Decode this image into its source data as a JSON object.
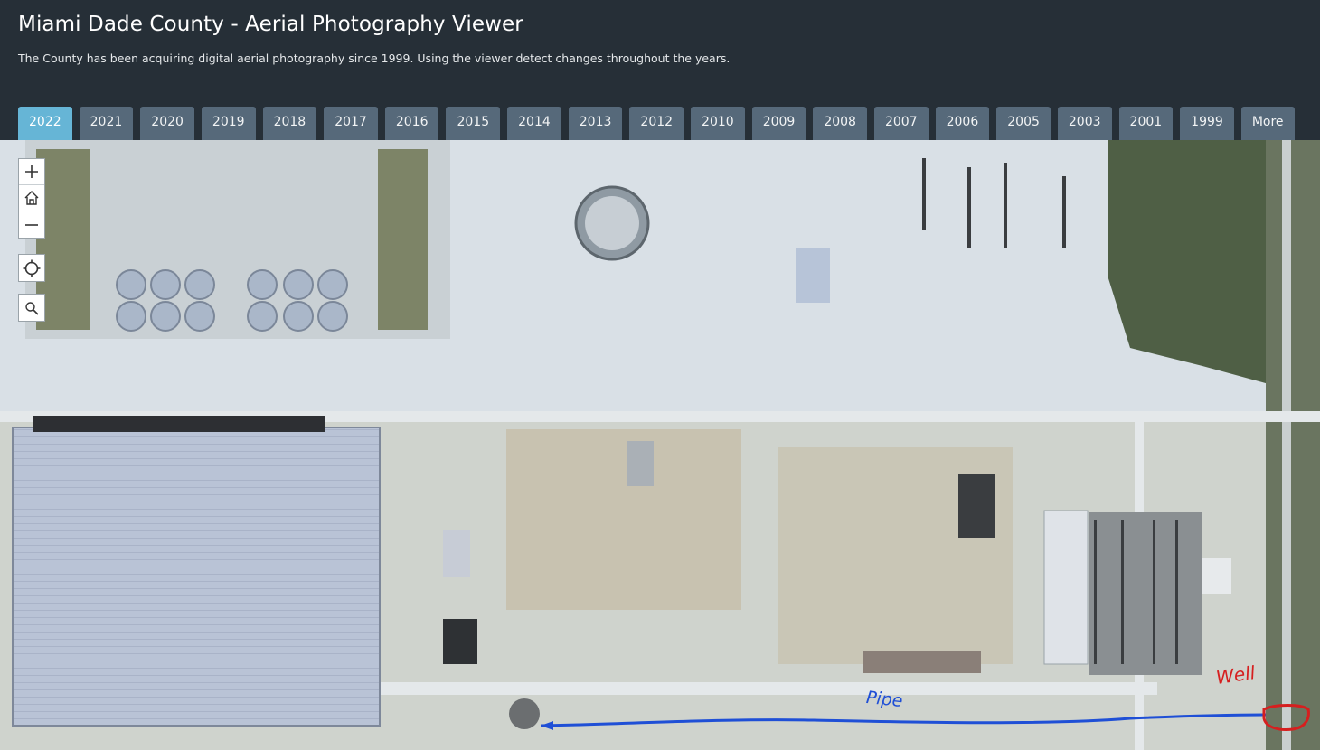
{
  "header": {
    "title": "Miami Dade County - Aerial Photography Viewer",
    "subtitle": "The County has been acquiring digital aerial photography since 1999. Using the viewer detect changes throughout the years."
  },
  "tabs": [
    {
      "label": "2022",
      "active": true
    },
    {
      "label": "2021"
    },
    {
      "label": "2020"
    },
    {
      "label": "2019"
    },
    {
      "label": "2018"
    },
    {
      "label": "2017"
    },
    {
      "label": "2016"
    },
    {
      "label": "2015"
    },
    {
      "label": "2014"
    },
    {
      "label": "2013"
    },
    {
      "label": "2012"
    },
    {
      "label": "2010"
    },
    {
      "label": "2009"
    },
    {
      "label": "2008"
    },
    {
      "label": "2007"
    },
    {
      "label": "2006"
    },
    {
      "label": "2005"
    },
    {
      "label": "2003"
    },
    {
      "label": "2001"
    },
    {
      "label": "1999"
    },
    {
      "label": "More"
    }
  ],
  "map_controls": {
    "zoom_in_icon": "plus-icon",
    "home_icon": "home-icon",
    "zoom_out_icon": "minus-icon",
    "locate_icon": "crosshair-icon",
    "search_icon": "magnifier-icon"
  },
  "annotations": {
    "pipe_label": "Pipe",
    "well_label": "Well"
  },
  "colors": {
    "header_bg": "#262f37",
    "tab_bg": "#56697a",
    "tab_active_bg": "#66b5d6",
    "pipe_line": "#1f4fd6",
    "well_marker": "#d61f1f"
  }
}
